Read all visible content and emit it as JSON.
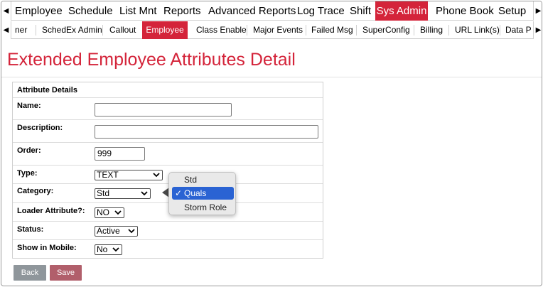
{
  "top_menu": {
    "items": [
      "Employee",
      "Schedule",
      "List Mnt",
      "Reports",
      "Advanced Reports",
      "Log Trace",
      "Shift",
      "Sys Admin",
      "Phone Book",
      "Setup"
    ],
    "active": "Sys Admin"
  },
  "sub_menu": {
    "items": [
      "ner",
      "SchedEx Admin",
      "Callout",
      "Employee",
      "Class Enable",
      "Major Events",
      "Failed Msg",
      "SuperConfig",
      "Billing",
      "URL Link(s)",
      "Data P"
    ],
    "active": "Employee"
  },
  "page": {
    "title": "Extended Employee Attributes Detail"
  },
  "form": {
    "header": "Attribute Details",
    "name_label": "Name:",
    "name_value": "",
    "description_label": "Description:",
    "description_value": "",
    "order_label": "Order:",
    "order_value": "999",
    "type_label": "Type:",
    "type_value": "TEXT",
    "category_label": "Category:",
    "category_value": "Std",
    "loader_label": "Loader Attribute?:",
    "loader_value": "NO",
    "status_label": "Status:",
    "status_value": "Active",
    "mobile_label": "Show in Mobile:",
    "mobile_value": "No"
  },
  "buttons": {
    "back": "Back",
    "save": "Save"
  },
  "category_dropdown": {
    "options": [
      "Std",
      "Quals",
      "Storm Role"
    ],
    "highlighted": "Quals"
  },
  "colors": {
    "accent": "#d4243a",
    "highlight": "#2a63d3"
  }
}
